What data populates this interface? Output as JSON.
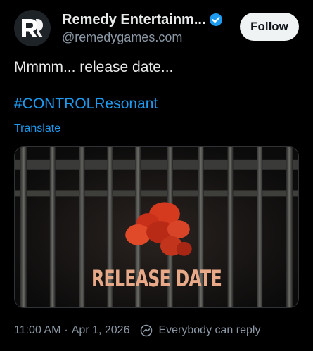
{
  "header": {
    "display_name": "Remedy Entertainm...",
    "handle": "@remedygames.com",
    "follow_label": "Follow",
    "avatar_icon": "remedy-r-logo",
    "verified_icon": "verified-badge-icon"
  },
  "post": {
    "text": "Mmmm... release date...",
    "hashtag": "#CONTROLResonant",
    "translate_label": "Translate",
    "media": {
      "caption": "RELEASE DATE",
      "description_icon": "prison-bars-image"
    }
  },
  "meta": {
    "time": "11:00 AM",
    "separator": "·",
    "date": "Apr 1, 2026",
    "reply_setting": "Everybody can reply",
    "reply_icon": "reply-permission-icon"
  },
  "colors": {
    "background": "#000000",
    "text": "#e7e9ea",
    "muted": "#8b98a5",
    "link": "#1d9bf0",
    "follow_bg": "#eff3f4",
    "caption": "#e8a989"
  }
}
